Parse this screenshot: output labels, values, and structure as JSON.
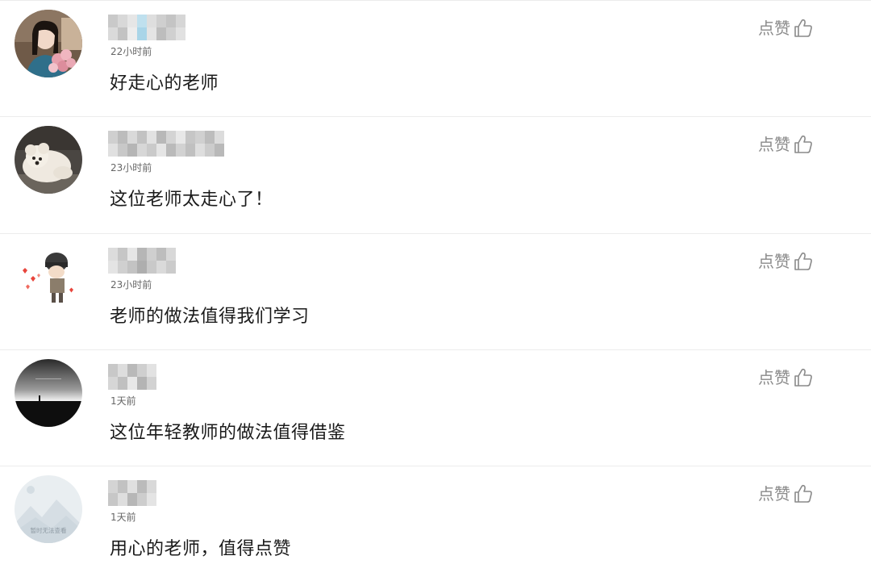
{
  "comments": [
    {
      "timestamp": "22小时前",
      "text": "好走心的老师",
      "like_label": "点赞",
      "avatar": "woman-with-flowers-avatar"
    },
    {
      "timestamp": "23小时前",
      "text": "这位老师太走心了！",
      "like_label": "点赞",
      "avatar": "white-puppy-avatar"
    },
    {
      "timestamp": "23小时前",
      "text": "老师的做法值得我们学习",
      "like_label": "点赞",
      "avatar": "cartoon-soldier-avatar"
    },
    {
      "timestamp": "1天前",
      "text": "这位年轻教师的做法值得借鉴",
      "like_label": "点赞",
      "avatar": "horizon-silhouette-avatar"
    },
    {
      "timestamp": "1天前",
      "text": "用心的老师，值得点赞",
      "like_label": "点赞",
      "avatar": "image-unavailable-avatar",
      "avatar_caption": "暂时无法查看"
    }
  ],
  "colors": {
    "text": "#1a1a1a",
    "meta": "#666666",
    "like": "#8a8a8a",
    "divider": "#ececec"
  }
}
